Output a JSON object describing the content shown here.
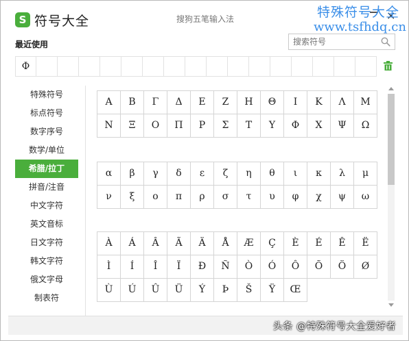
{
  "window": {
    "app_title": "符号大全",
    "logo_letter": "S",
    "ime_name": "搜狗五笔输入法",
    "close_label": "×"
  },
  "watermark": {
    "line1": "特殊符号大全",
    "line2": "www.tsfhdq.cn"
  },
  "recent": {
    "label": "最近使用",
    "cells": [
      "Φ",
      "",
      "",
      "",
      "",
      "",
      "",
      "",
      "",
      "",
      "",
      "",
      "",
      "",
      "",
      "",
      ""
    ]
  },
  "search": {
    "placeholder": "搜索符号"
  },
  "sidebar": {
    "items": [
      {
        "label": "特殊符号"
      },
      {
        "label": "标点符号"
      },
      {
        "label": "数字序号"
      },
      {
        "label": "数学/单位"
      },
      {
        "label": "希腊/拉丁"
      },
      {
        "label": "拼音/注音"
      },
      {
        "label": "中文字符"
      },
      {
        "label": "英文音标"
      },
      {
        "label": "日文字符"
      },
      {
        "label": "韩文字符"
      },
      {
        "label": "俄文字母"
      },
      {
        "label": "制表符"
      }
    ],
    "active_index": 4
  },
  "symbol_groups": [
    {
      "rows": [
        [
          "Α",
          "Β",
          "Γ",
          "Δ",
          "Ε",
          "Ζ",
          "Η",
          "Θ",
          "Ι",
          "Κ",
          "Λ",
          "Μ"
        ],
        [
          "Ν",
          "Ξ",
          "Ο",
          "Π",
          "Ρ",
          "Σ",
          "Τ",
          "Υ",
          "Φ",
          "Χ",
          "Ψ",
          "Ω"
        ]
      ]
    },
    {
      "rows": [
        [
          "α",
          "β",
          "γ",
          "δ",
          "ε",
          "ζ",
          "η",
          "θ",
          "ι",
          "κ",
          "λ",
          "μ"
        ],
        [
          "ν",
          "ξ",
          "ο",
          "π",
          "ρ",
          "σ",
          "τ",
          "υ",
          "φ",
          "χ",
          "ψ",
          "ω"
        ]
      ]
    },
    {
      "rows": [
        [
          "À",
          "Á",
          "Â",
          "Ã",
          "Ä",
          "Å",
          "Æ",
          "Ç",
          "È",
          "É",
          "Ê",
          "Ë"
        ],
        [
          "Ì",
          "Í",
          "Î",
          "Ï",
          "Ð",
          "Ñ",
          "Ò",
          "Ó",
          "Ô",
          "Õ",
          "Ö",
          "Ø"
        ],
        [
          "Ù",
          "Ú",
          "Û",
          "Ü",
          "Ý",
          "Þ",
          "Š",
          "Ÿ",
          "Œ"
        ]
      ]
    }
  ],
  "scrollbar": {
    "position_fraction": 0.0,
    "visible_fraction": 0.44
  },
  "footer": {
    "credit": "头条 @特殊符号大全爱好者"
  },
  "colors": {
    "accent": "#4aae3c",
    "watermark": "#3a8ee8"
  },
  "icons": {
    "logo": "sogou-logo-icon",
    "search": "search-icon",
    "trash": "trash-icon",
    "close": "close-icon",
    "minimize": "minimize-icon"
  }
}
